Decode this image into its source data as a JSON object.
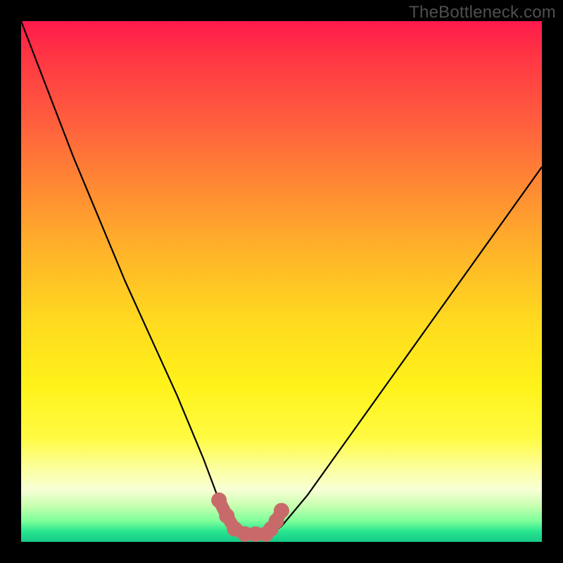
{
  "watermark": "TheBottleneck.com",
  "colors": {
    "background": "#000000",
    "curve_stroke": "#000000",
    "marker_fill": "#c96a6a",
    "marker_stroke": "#c96a6a"
  },
  "chart_data": {
    "type": "line",
    "title": "",
    "xlabel": "",
    "ylabel": "",
    "xlim": [
      0,
      100
    ],
    "ylim": [
      0,
      100
    ],
    "note": "Axes unlabeled; values are normalized 0–100 estimated from pixel positions. y=0 at bottom (green), y=100 at top (red). Curve is a V-shaped bottleneck dip.",
    "series": [
      {
        "name": "bottleneck-curve",
        "x": [
          0,
          5,
          10,
          15,
          20,
          25,
          30,
          35,
          38,
          41,
          44,
          47,
          50,
          55,
          60,
          65,
          70,
          75,
          80,
          85,
          90,
          95,
          100
        ],
        "y": [
          100,
          87,
          74,
          62,
          50,
          39,
          28,
          16,
          8,
          3,
          1,
          1,
          3,
          9,
          16,
          23,
          30,
          37,
          44,
          51,
          58,
          65,
          72
        ]
      },
      {
        "name": "highlighted-points",
        "type": "scatter",
        "x": [
          38,
          39.5,
          41,
          43,
          45,
          47,
          48,
          49,
          50
        ],
        "y": [
          8,
          5,
          2.5,
          1.5,
          1.5,
          1.5,
          2.5,
          4,
          6
        ]
      }
    ]
  }
}
